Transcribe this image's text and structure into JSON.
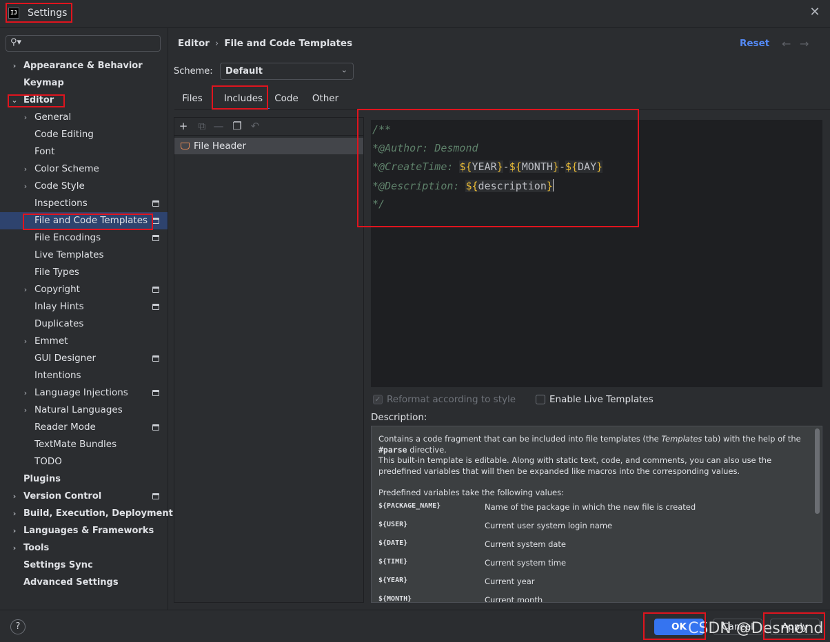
{
  "window": {
    "title": "Settings",
    "logo": "IJ"
  },
  "search": {
    "placeholder": ""
  },
  "sidebar": {
    "items": [
      {
        "label": "Appearance & Behavior",
        "level": 0,
        "expandable": true
      },
      {
        "label": "Keymap",
        "level": 0,
        "expandable": false
      },
      {
        "label": "Editor",
        "level": 0,
        "expandable": true,
        "expanded": true
      },
      {
        "label": "General",
        "level": 1,
        "expandable": true
      },
      {
        "label": "Code Editing",
        "level": 1
      },
      {
        "label": "Font",
        "level": 1
      },
      {
        "label": "Color Scheme",
        "level": 1,
        "expandable": true
      },
      {
        "label": "Code Style",
        "level": 1,
        "expandable": true
      },
      {
        "label": "Inspections",
        "level": 1,
        "project_icon": true
      },
      {
        "label": "File and Code Templates",
        "level": 1,
        "selected": true,
        "project_icon": true
      },
      {
        "label": "File Encodings",
        "level": 1,
        "project_icon": true
      },
      {
        "label": "Live Templates",
        "level": 1
      },
      {
        "label": "File Types",
        "level": 1
      },
      {
        "label": "Copyright",
        "level": 1,
        "expandable": true,
        "project_icon": true
      },
      {
        "label": "Inlay Hints",
        "level": 1,
        "project_icon": true
      },
      {
        "label": "Duplicates",
        "level": 1
      },
      {
        "label": "Emmet",
        "level": 1,
        "expandable": true
      },
      {
        "label": "GUI Designer",
        "level": 1,
        "project_icon": true
      },
      {
        "label": "Intentions",
        "level": 1
      },
      {
        "label": "Language Injections",
        "level": 1,
        "expandable": true,
        "project_icon": true
      },
      {
        "label": "Natural Languages",
        "level": 1,
        "expandable": true
      },
      {
        "label": "Reader Mode",
        "level": 1,
        "project_icon": true
      },
      {
        "label": "TextMate Bundles",
        "level": 1
      },
      {
        "label": "TODO",
        "level": 1
      },
      {
        "label": "Plugins",
        "level": 0
      },
      {
        "label": "Version Control",
        "level": 0,
        "expandable": true,
        "project_icon": true
      },
      {
        "label": "Build, Execution, Deployment",
        "level": 0,
        "expandable": true
      },
      {
        "label": "Languages & Frameworks",
        "level": 0,
        "expandable": true
      },
      {
        "label": "Tools",
        "level": 0,
        "expandable": true
      },
      {
        "label": "Settings Sync",
        "level": 0
      },
      {
        "label": "Advanced Settings",
        "level": 0
      }
    ]
  },
  "header": {
    "breadcrumb_parent": "Editor",
    "breadcrumb_sep": "›",
    "breadcrumb_current": "File and Code Templates",
    "reset_label": "Reset",
    "back_arrow": "←",
    "forward_arrow": "→"
  },
  "scheme": {
    "label": "Scheme:",
    "value": "Default"
  },
  "tabs": [
    {
      "label": "Files"
    },
    {
      "label": "Includes",
      "active": true
    },
    {
      "label": "Code"
    },
    {
      "label": "Other"
    }
  ],
  "template_list": {
    "toolbar_icons": [
      "add-icon",
      "copy-template-icon",
      "remove-icon",
      "duplicate-icon",
      "reset-icon"
    ],
    "items": [
      {
        "label": "File Header",
        "selected": true
      }
    ]
  },
  "editor": {
    "line1": "/**",
    "line2_tag": "*@Author: ",
    "line2_value": "Desmond",
    "line3_tag": "*@CreateTime: ",
    "line3_dash": "-",
    "line4_tag": "*@Description: ",
    "line5": "*/",
    "var_prefix": "${",
    "var_suffix": "}",
    "var_year": "YEAR",
    "var_month": "MONTH",
    "var_day": "DAY",
    "var_description": "description"
  },
  "options": {
    "reformat_label": "Reformat according to style",
    "reformat_checked": true,
    "reformat_enabled": false,
    "live_templates_label": "Enable Live Templates",
    "live_templates_checked": false
  },
  "description": {
    "label": "Description:",
    "p1_start": "Contains a code fragment that can be included into file templates (the ",
    "p1_em": "Templates",
    "p1_mid": " tab) with the help of the ",
    "p1_code": "#parse",
    "p1_end": " directive.",
    "p2": "This built-in template is editable. Along with static text, code, and comments, you can also use the predefined variables that will then be expanded like macros into the corresponding values.",
    "p3": "Predefined variables take the following values:",
    "variables": [
      {
        "name": "${PACKAGE_NAME}",
        "desc": "Name of the package in which the new file is created"
      },
      {
        "name": "${USER}",
        "desc": "Current user system login name"
      },
      {
        "name": "${DATE}",
        "desc": "Current system date"
      },
      {
        "name": "${TIME}",
        "desc": "Current system time"
      },
      {
        "name": "${YEAR}",
        "desc": "Current year"
      },
      {
        "name": "${MONTH}",
        "desc": "Current month"
      }
    ]
  },
  "footer": {
    "help_label": "?",
    "ok_label": "OK",
    "cancel_label": "Cancel",
    "apply_label": "Apply",
    "watermark": "CSDN @Desmond"
  }
}
